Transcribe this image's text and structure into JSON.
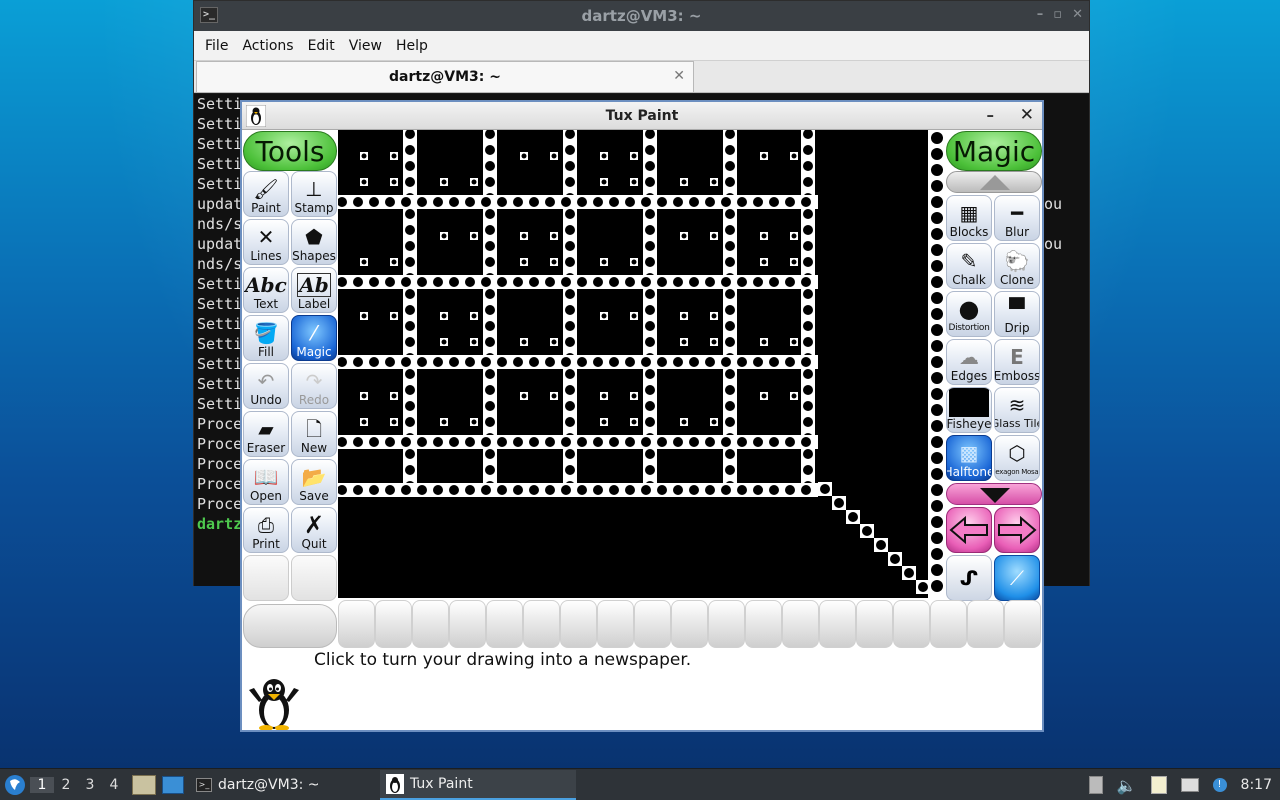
{
  "terminal": {
    "title": "dartz@VM3: ~",
    "menu": [
      "File",
      "Actions",
      "Edit",
      "View",
      "Help"
    ],
    "tab_label": "dartz@VM3: ~",
    "lines": [
      "Setti",
      "Setti",
      "Setti",
      "Setti",
      "Setti",
      "updat",
      "nds/s",
      "updat",
      "nds/s",
      "Setti",
      "Setti",
      "Setti",
      "Setti",
      "Setti",
      "Setti",
      "Setti",
      "Proce",
      "Proce",
      "Proce",
      "Proce",
      "Proce"
    ],
    "prompt_line": "dartz",
    "right_fragment_1": "ou",
    "right_fragment_2": "ou"
  },
  "tuxpaint": {
    "title": "Tux Paint",
    "tools_header": "Tools",
    "magic_header": "Magic",
    "tools": [
      {
        "label": "Paint",
        "icon": "paintbrush-icon"
      },
      {
        "label": "Stamp",
        "icon": "stamp-icon"
      },
      {
        "label": "Lines",
        "icon": "lines-icon"
      },
      {
        "label": "Shapes",
        "icon": "pentagon-icon"
      },
      {
        "label": "Text",
        "icon": "text-abc-icon"
      },
      {
        "label": "Label",
        "icon": "label-abc-icon"
      },
      {
        "label": "Fill",
        "icon": "paint-bucket-icon"
      },
      {
        "label": "Magic",
        "icon": "magic-wand-icon",
        "selected": true
      },
      {
        "label": "Undo",
        "icon": "undo-icon",
        "disabled": false
      },
      {
        "label": "Redo",
        "icon": "redo-icon",
        "disabled": true
      },
      {
        "label": "Eraser",
        "icon": "eraser-icon"
      },
      {
        "label": "New",
        "icon": "new-page-icon"
      },
      {
        "label": "Open",
        "icon": "open-book-icon"
      },
      {
        "label": "Save",
        "icon": "save-icon"
      },
      {
        "label": "Print",
        "icon": "printer-icon"
      },
      {
        "label": "Quit",
        "icon": "quit-x-icon"
      }
    ],
    "magic_tools": [
      {
        "label": "Blocks",
        "icon": "blocks-icon"
      },
      {
        "label": "Blur",
        "icon": "blur-icon"
      },
      {
        "label": "Chalk",
        "icon": "chalk-icon"
      },
      {
        "label": "Clone",
        "icon": "clone-sheep-icon"
      },
      {
        "label": "Distortion",
        "icon": "distortion-icon"
      },
      {
        "label": "Drip",
        "icon": "drip-icon"
      },
      {
        "label": "Edges",
        "icon": "edges-icon"
      },
      {
        "label": "Emboss",
        "icon": "emboss-icon"
      },
      {
        "label": "Fisheye",
        "icon": "fisheye-icon"
      },
      {
        "label": "Glass Tile",
        "icon": "glass-tile-icon"
      },
      {
        "label": "Halftone",
        "icon": "halftone-icon",
        "selected": true
      },
      {
        "label": "Hexagon Mosaic",
        "icon": "hexagon-mosaic-icon"
      }
    ],
    "status_message": "Click to turn your drawing into a newspaper."
  },
  "taskbar": {
    "workspaces": [
      "1",
      "2",
      "3",
      "4"
    ],
    "tasks": [
      {
        "label": "dartz@VM3: ~",
        "icon": "terminal-icon"
      },
      {
        "label": "Tux Paint",
        "icon": "tuxpaint-icon"
      }
    ],
    "clock": "8:17"
  },
  "colors": {
    "accent_selected": "#1a66d6",
    "tools_header_green": "#4dc13a",
    "nav_pink": "#e95fb7"
  }
}
